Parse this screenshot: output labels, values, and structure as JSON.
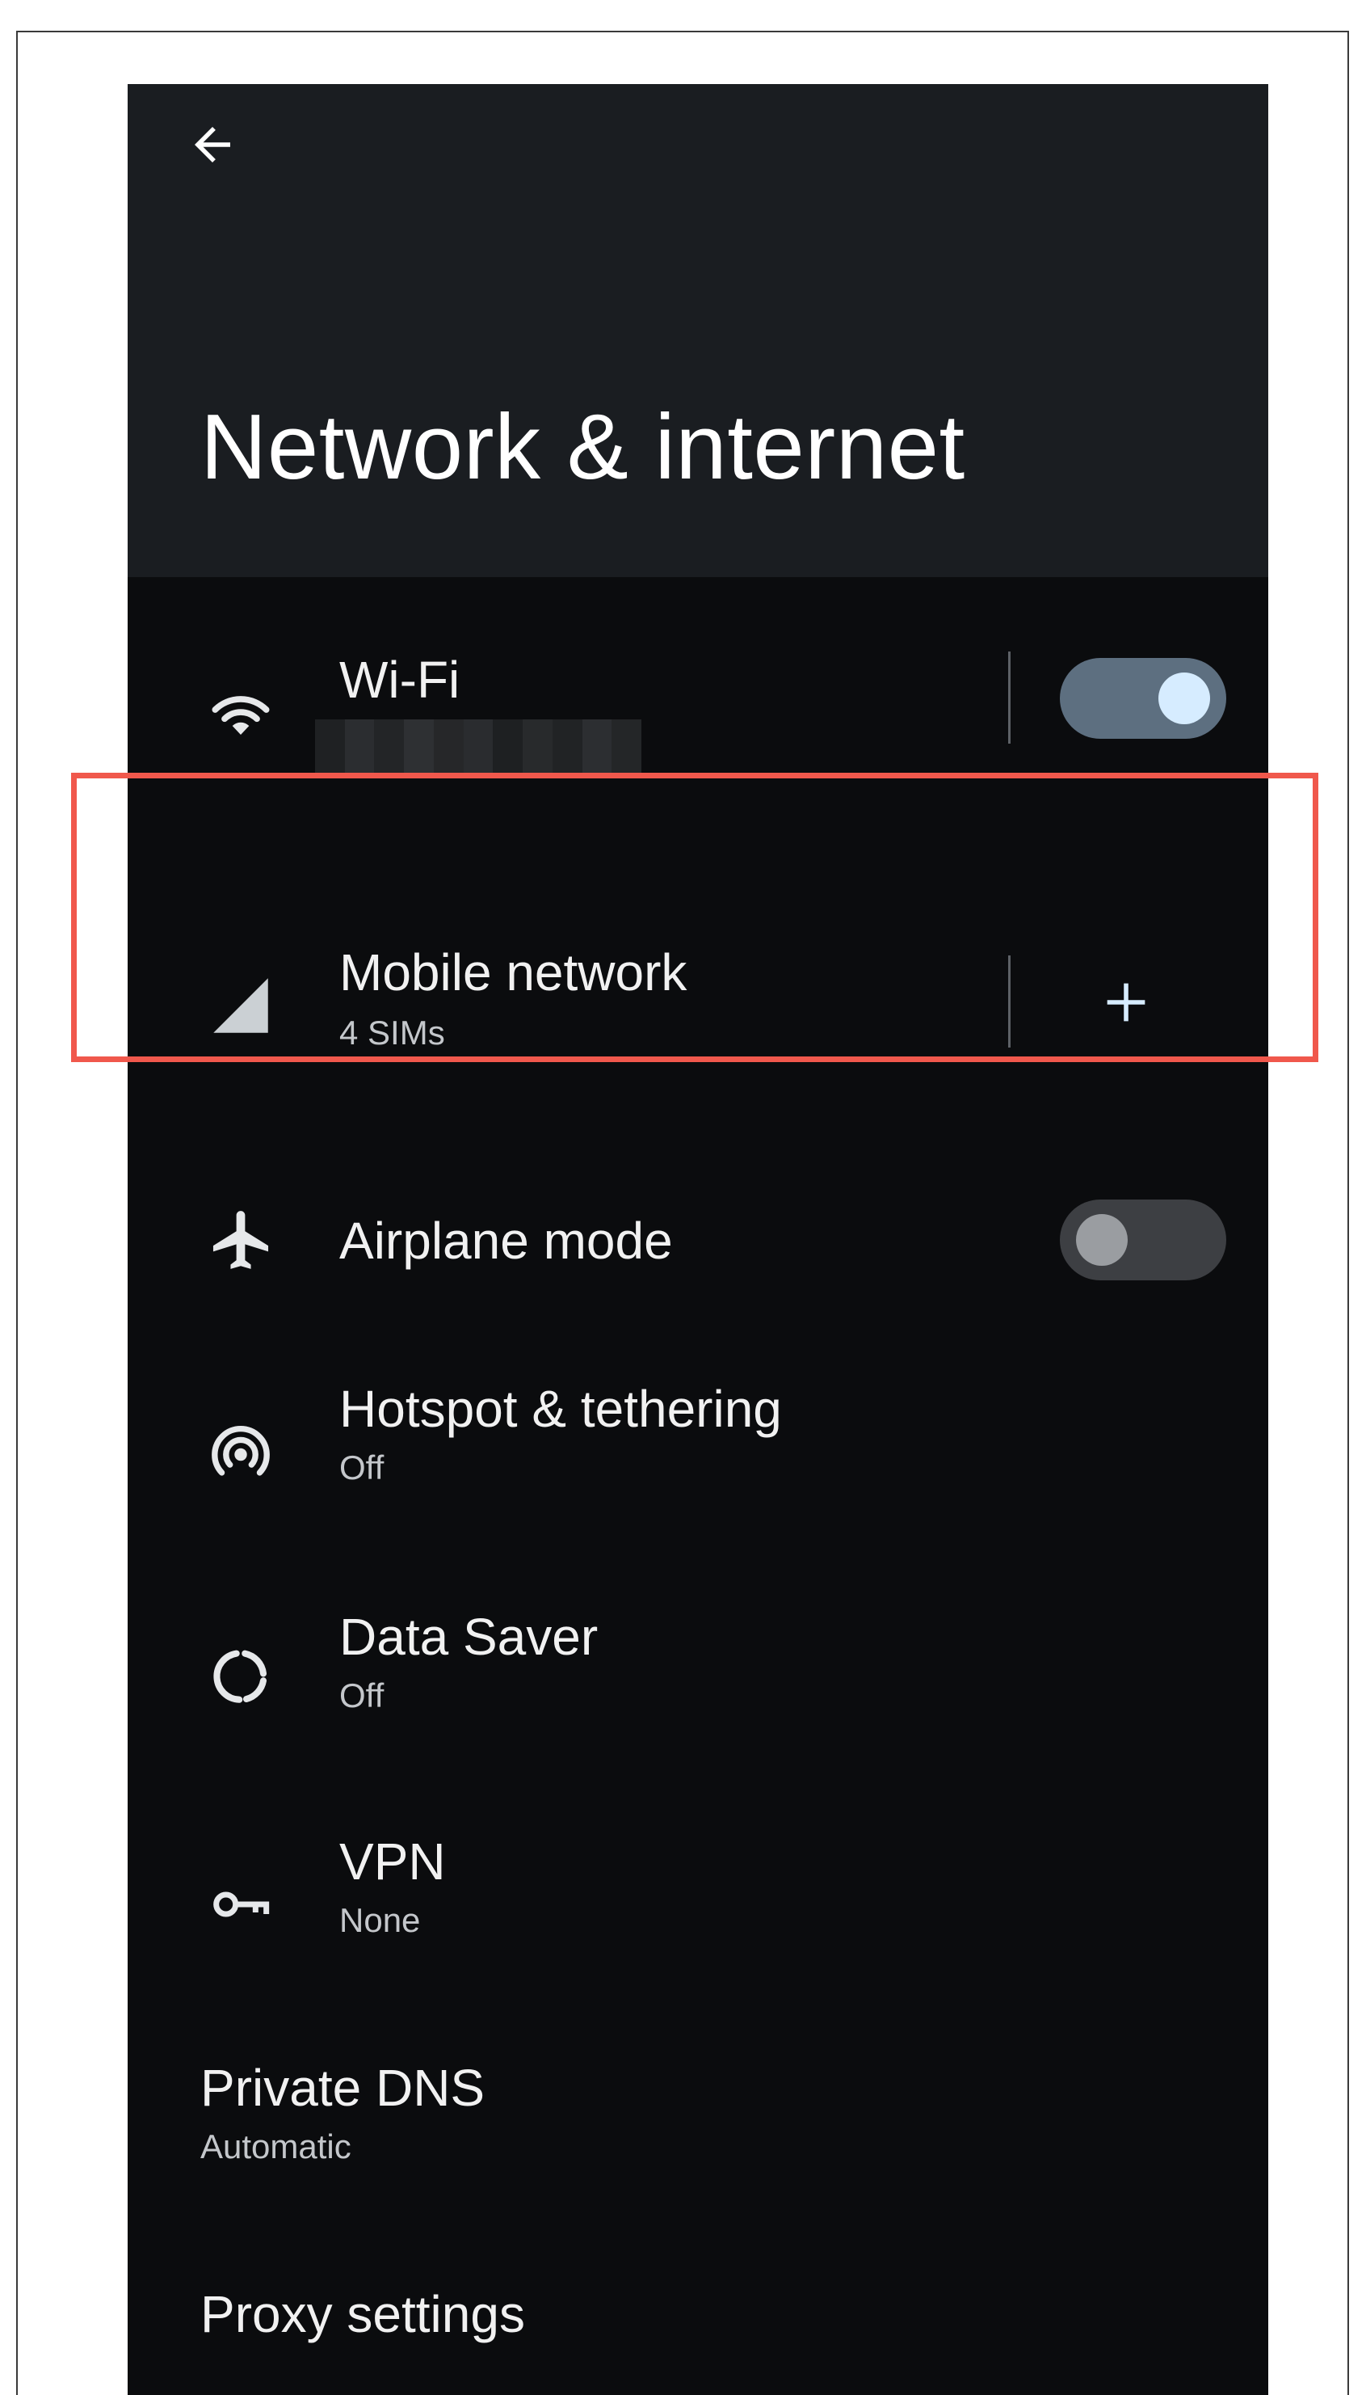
{
  "header": {
    "title": "Network & internet",
    "back_icon": "arrow-left-icon"
  },
  "settings": {
    "wifi": {
      "label": "Wi-Fi",
      "icon": "wifi-icon",
      "toggle_on": true
    },
    "mobile_network": {
      "label": "Mobile network",
      "subtitle": "4 SIMs",
      "icon": "cellular-signal-icon",
      "action_icon": "plus-icon"
    },
    "airplane_mode": {
      "label": "Airplane mode",
      "icon": "airplane-icon",
      "toggle_on": false
    },
    "hotspot": {
      "label": "Hotspot & tethering",
      "subtitle": "Off",
      "icon": "hotspot-icon"
    },
    "data_saver": {
      "label": "Data Saver",
      "subtitle": "Off",
      "icon": "data-saver-icon"
    },
    "vpn": {
      "label": "VPN",
      "subtitle": "None",
      "icon": "key-icon"
    },
    "private_dns": {
      "label": "Private DNS",
      "subtitle": "Automatic"
    },
    "proxy": {
      "label": "Proxy settings"
    }
  },
  "colors": {
    "header_background": "#1a1d21",
    "list_background": "#0b0c0e",
    "highlight_border": "#f0584c",
    "toggle_on_track": "#5d6f80",
    "toggle_on_knob": "#d6ecff",
    "toggle_off_track": "#3d3f43"
  }
}
